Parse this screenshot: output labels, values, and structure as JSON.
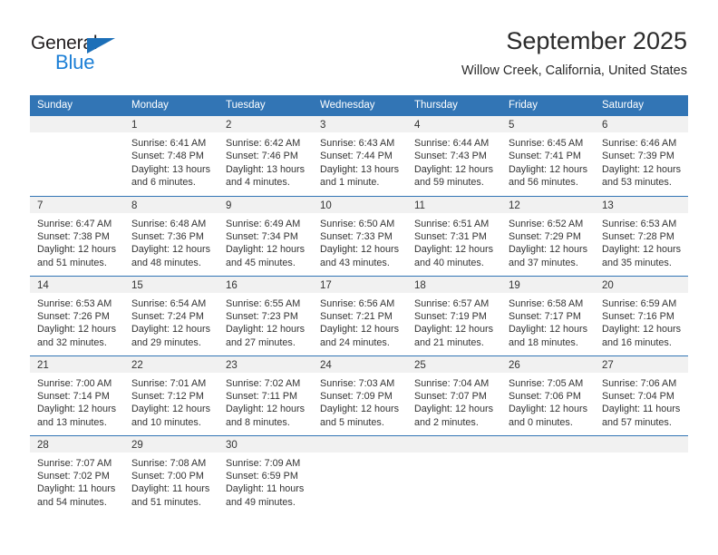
{
  "logo": {
    "word_dark": "General",
    "word_blue": "Blue",
    "triangle_color": "#1c6fb8",
    "blue_text_color": "#1c7fd6"
  },
  "header": {
    "month_title": "September 2025",
    "location": "Willow Creek, California, United States"
  },
  "theme": {
    "header_blue": "#3275b5",
    "daynum_band": "#f1f1f1",
    "text": "#333333"
  },
  "calendar": {
    "weekdays": [
      "Sunday",
      "Monday",
      "Tuesday",
      "Wednesday",
      "Thursday",
      "Friday",
      "Saturday"
    ],
    "weeks": [
      [
        {
          "day": "",
          "sunrise": "",
          "sunset": "",
          "daylight_line1": "",
          "daylight_line2": "",
          "empty": true
        },
        {
          "day": "1",
          "sunrise": "Sunrise: 6:41 AM",
          "sunset": "Sunset: 7:48 PM",
          "daylight_line1": "Daylight: 13 hours",
          "daylight_line2": "and 6 minutes."
        },
        {
          "day": "2",
          "sunrise": "Sunrise: 6:42 AM",
          "sunset": "Sunset: 7:46 PM",
          "daylight_line1": "Daylight: 13 hours",
          "daylight_line2": "and 4 minutes."
        },
        {
          "day": "3",
          "sunrise": "Sunrise: 6:43 AM",
          "sunset": "Sunset: 7:44 PM",
          "daylight_line1": "Daylight: 13 hours",
          "daylight_line2": "and 1 minute."
        },
        {
          "day": "4",
          "sunrise": "Sunrise: 6:44 AM",
          "sunset": "Sunset: 7:43 PM",
          "daylight_line1": "Daylight: 12 hours",
          "daylight_line2": "and 59 minutes."
        },
        {
          "day": "5",
          "sunrise": "Sunrise: 6:45 AM",
          "sunset": "Sunset: 7:41 PM",
          "daylight_line1": "Daylight: 12 hours",
          "daylight_line2": "and 56 minutes."
        },
        {
          "day": "6",
          "sunrise": "Sunrise: 6:46 AM",
          "sunset": "Sunset: 7:39 PM",
          "daylight_line1": "Daylight: 12 hours",
          "daylight_line2": "and 53 minutes."
        }
      ],
      [
        {
          "day": "7",
          "sunrise": "Sunrise: 6:47 AM",
          "sunset": "Sunset: 7:38 PM",
          "daylight_line1": "Daylight: 12 hours",
          "daylight_line2": "and 51 minutes."
        },
        {
          "day": "8",
          "sunrise": "Sunrise: 6:48 AM",
          "sunset": "Sunset: 7:36 PM",
          "daylight_line1": "Daylight: 12 hours",
          "daylight_line2": "and 48 minutes."
        },
        {
          "day": "9",
          "sunrise": "Sunrise: 6:49 AM",
          "sunset": "Sunset: 7:34 PM",
          "daylight_line1": "Daylight: 12 hours",
          "daylight_line2": "and 45 minutes."
        },
        {
          "day": "10",
          "sunrise": "Sunrise: 6:50 AM",
          "sunset": "Sunset: 7:33 PM",
          "daylight_line1": "Daylight: 12 hours",
          "daylight_line2": "and 43 minutes."
        },
        {
          "day": "11",
          "sunrise": "Sunrise: 6:51 AM",
          "sunset": "Sunset: 7:31 PM",
          "daylight_line1": "Daylight: 12 hours",
          "daylight_line2": "and 40 minutes."
        },
        {
          "day": "12",
          "sunrise": "Sunrise: 6:52 AM",
          "sunset": "Sunset: 7:29 PM",
          "daylight_line1": "Daylight: 12 hours",
          "daylight_line2": "and 37 minutes."
        },
        {
          "day": "13",
          "sunrise": "Sunrise: 6:53 AM",
          "sunset": "Sunset: 7:28 PM",
          "daylight_line1": "Daylight: 12 hours",
          "daylight_line2": "and 35 minutes."
        }
      ],
      [
        {
          "day": "14",
          "sunrise": "Sunrise: 6:53 AM",
          "sunset": "Sunset: 7:26 PM",
          "daylight_line1": "Daylight: 12 hours",
          "daylight_line2": "and 32 minutes."
        },
        {
          "day": "15",
          "sunrise": "Sunrise: 6:54 AM",
          "sunset": "Sunset: 7:24 PM",
          "daylight_line1": "Daylight: 12 hours",
          "daylight_line2": "and 29 minutes."
        },
        {
          "day": "16",
          "sunrise": "Sunrise: 6:55 AM",
          "sunset": "Sunset: 7:23 PM",
          "daylight_line1": "Daylight: 12 hours",
          "daylight_line2": "and 27 minutes."
        },
        {
          "day": "17",
          "sunrise": "Sunrise: 6:56 AM",
          "sunset": "Sunset: 7:21 PM",
          "daylight_line1": "Daylight: 12 hours",
          "daylight_line2": "and 24 minutes."
        },
        {
          "day": "18",
          "sunrise": "Sunrise: 6:57 AM",
          "sunset": "Sunset: 7:19 PM",
          "daylight_line1": "Daylight: 12 hours",
          "daylight_line2": "and 21 minutes."
        },
        {
          "day": "19",
          "sunrise": "Sunrise: 6:58 AM",
          "sunset": "Sunset: 7:17 PM",
          "daylight_line1": "Daylight: 12 hours",
          "daylight_line2": "and 18 minutes."
        },
        {
          "day": "20",
          "sunrise": "Sunrise: 6:59 AM",
          "sunset": "Sunset: 7:16 PM",
          "daylight_line1": "Daylight: 12 hours",
          "daylight_line2": "and 16 minutes."
        }
      ],
      [
        {
          "day": "21",
          "sunrise": "Sunrise: 7:00 AM",
          "sunset": "Sunset: 7:14 PM",
          "daylight_line1": "Daylight: 12 hours",
          "daylight_line2": "and 13 minutes."
        },
        {
          "day": "22",
          "sunrise": "Sunrise: 7:01 AM",
          "sunset": "Sunset: 7:12 PM",
          "daylight_line1": "Daylight: 12 hours",
          "daylight_line2": "and 10 minutes."
        },
        {
          "day": "23",
          "sunrise": "Sunrise: 7:02 AM",
          "sunset": "Sunset: 7:11 PM",
          "daylight_line1": "Daylight: 12 hours",
          "daylight_line2": "and 8 minutes."
        },
        {
          "day": "24",
          "sunrise": "Sunrise: 7:03 AM",
          "sunset": "Sunset: 7:09 PM",
          "daylight_line1": "Daylight: 12 hours",
          "daylight_line2": "and 5 minutes."
        },
        {
          "day": "25",
          "sunrise": "Sunrise: 7:04 AM",
          "sunset": "Sunset: 7:07 PM",
          "daylight_line1": "Daylight: 12 hours",
          "daylight_line2": "and 2 minutes."
        },
        {
          "day": "26",
          "sunrise": "Sunrise: 7:05 AM",
          "sunset": "Sunset: 7:06 PM",
          "daylight_line1": "Daylight: 12 hours",
          "daylight_line2": "and 0 minutes."
        },
        {
          "day": "27",
          "sunrise": "Sunrise: 7:06 AM",
          "sunset": "Sunset: 7:04 PM",
          "daylight_line1": "Daylight: 11 hours",
          "daylight_line2": "and 57 minutes."
        }
      ],
      [
        {
          "day": "28",
          "sunrise": "Sunrise: 7:07 AM",
          "sunset": "Sunset: 7:02 PM",
          "daylight_line1": "Daylight: 11 hours",
          "daylight_line2": "and 54 minutes."
        },
        {
          "day": "29",
          "sunrise": "Sunrise: 7:08 AM",
          "sunset": "Sunset: 7:00 PM",
          "daylight_line1": "Daylight: 11 hours",
          "daylight_line2": "and 51 minutes."
        },
        {
          "day": "30",
          "sunrise": "Sunrise: 7:09 AM",
          "sunset": "Sunset: 6:59 PM",
          "daylight_line1": "Daylight: 11 hours",
          "daylight_line2": "and 49 minutes."
        },
        {
          "day": "",
          "sunrise": "",
          "sunset": "",
          "daylight_line1": "",
          "daylight_line2": "",
          "empty": true
        },
        {
          "day": "",
          "sunrise": "",
          "sunset": "",
          "daylight_line1": "",
          "daylight_line2": "",
          "empty": true
        },
        {
          "day": "",
          "sunrise": "",
          "sunset": "",
          "daylight_line1": "",
          "daylight_line2": "",
          "empty": true
        },
        {
          "day": "",
          "sunrise": "",
          "sunset": "",
          "daylight_line1": "",
          "daylight_line2": "",
          "empty": true
        }
      ]
    ]
  }
}
